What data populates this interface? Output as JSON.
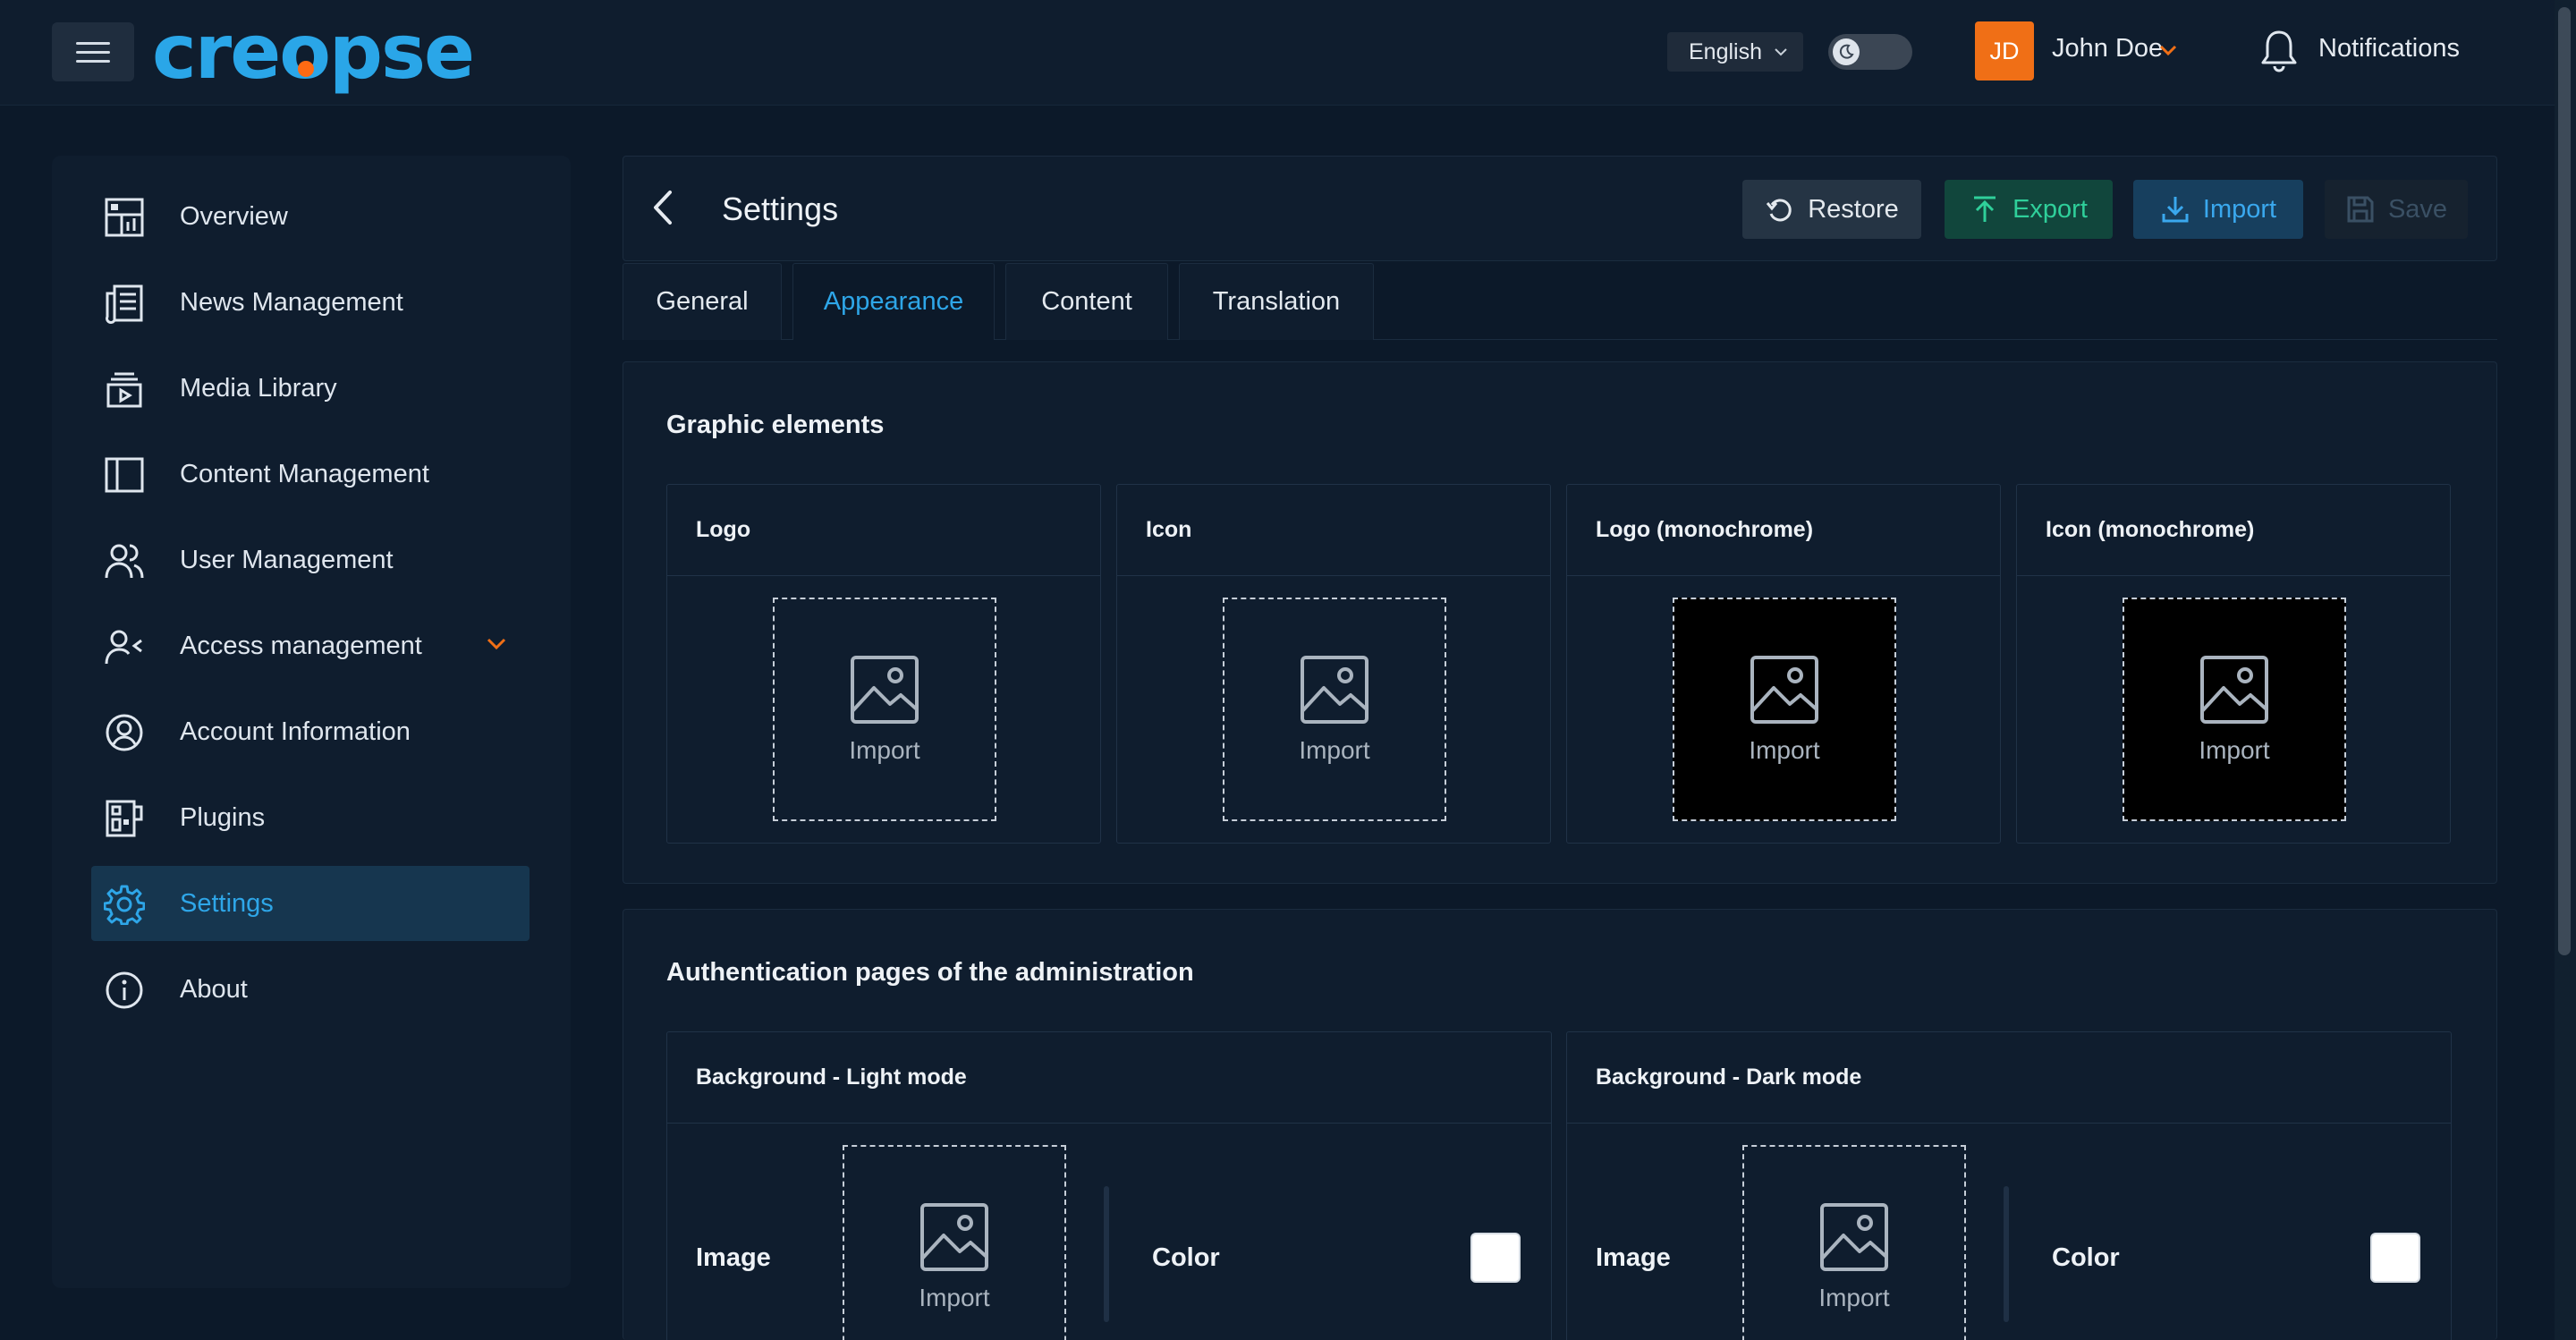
{
  "app": {
    "brand": "creopse"
  },
  "topbar": {
    "menu_icon": "menu-icon",
    "language": "English",
    "theme_toggle_icon": "moon-icon",
    "avatar_initials": "JD",
    "user_name": "John Doe",
    "notifications_label": "Notifications",
    "notifications_icon": "bell-icon"
  },
  "sidebar": {
    "items": [
      {
        "label": "Overview",
        "icon": "dashboard-icon"
      },
      {
        "label": "News Management",
        "icon": "newspaper-icon"
      },
      {
        "label": "Media Library",
        "icon": "media-library-icon"
      },
      {
        "label": "Content Management",
        "icon": "layout-icon"
      },
      {
        "label": "User Management",
        "icon": "users-icon"
      },
      {
        "label": "Access management",
        "icon": "user-access-icon"
      },
      {
        "label": "Account Information",
        "icon": "account-circle-icon"
      },
      {
        "label": "Plugins",
        "icon": "plugins-icon"
      },
      {
        "label": "Settings",
        "icon": "gear-icon",
        "active": true
      },
      {
        "label": "About",
        "icon": "info-icon"
      }
    ]
  },
  "header": {
    "title": "Settings",
    "restore_label": "Restore",
    "export_label": "Export",
    "import_label": "Import",
    "save_label": "Save"
  },
  "tabs": [
    {
      "label": "General"
    },
    {
      "label": "Appearance",
      "active": true
    },
    {
      "label": "Content"
    },
    {
      "label": "Translation"
    }
  ],
  "graphic_elements": {
    "title": "Graphic elements",
    "cards": [
      {
        "title": "Logo",
        "import_label": "Import",
        "dark": false
      },
      {
        "title": "Icon",
        "import_label": "Import",
        "dark": false
      },
      {
        "title": "Logo (monochrome)",
        "import_label": "Import",
        "dark": true
      },
      {
        "title": "Icon (monochrome)",
        "import_label": "Import",
        "dark": true
      }
    ]
  },
  "auth_pages": {
    "title": "Authentication pages of the administration",
    "cards": [
      {
        "title": "Background - Light mode",
        "image_label": "Image",
        "import_label": "Import",
        "color_label": "Color",
        "color_value": "#ffffff"
      },
      {
        "title": "Background - Dark mode",
        "image_label": "Image",
        "import_label": "Import",
        "color_label": "Color",
        "color_value": "#ffffff"
      }
    ]
  },
  "colors": {
    "accent": "#2ea6e8",
    "brand_orange": "#f06f16",
    "export_green": "#2fcf9a",
    "background": "#0c1929"
  }
}
